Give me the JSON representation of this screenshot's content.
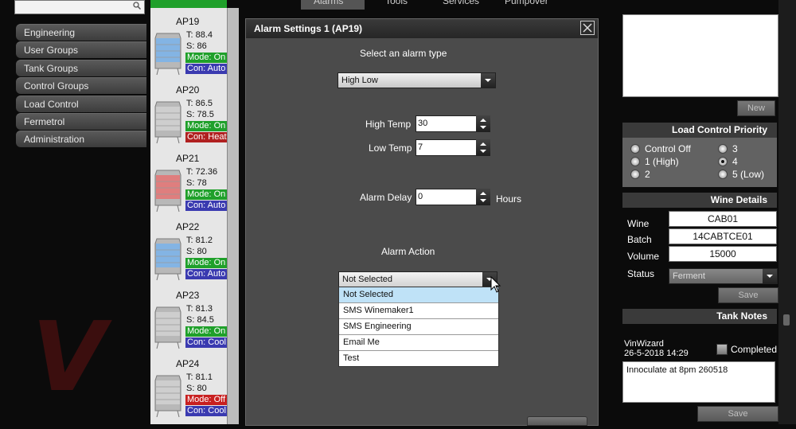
{
  "nav": {
    "items": [
      "Engineering",
      "User Groups",
      "Tank Groups",
      "Control Groups",
      "Load Control",
      "Fermetrol",
      "Administration"
    ]
  },
  "tanks": [
    {
      "name": "AP19",
      "t": "T: 88.4",
      "s": "S: 86",
      "mode": "Mode: On",
      "con": "Con: Auto",
      "fill": "blue"
    },
    {
      "name": "AP20",
      "t": "T: 86.5",
      "s": "S: 78.5",
      "mode": "Mode: On",
      "con": "Con: Heat",
      "fill": "none"
    },
    {
      "name": "AP21",
      "t": "T: 72.36",
      "s": "S: 78",
      "mode": "Mode: On",
      "con": "Con: Auto",
      "fill": "red"
    },
    {
      "name": "AP22",
      "t": "T: 81.2",
      "s": "S: 80",
      "mode": "Mode: On",
      "con": "Con: Auto",
      "fill": "blue"
    },
    {
      "name": "AP23",
      "t": "T: 81.3",
      "s": "S: 84.5",
      "mode": "Mode: On",
      "con": "Con: Cool",
      "fill": "none"
    },
    {
      "name": "AP24",
      "t": "T: 81.1",
      "s": "S: 80",
      "mode": "Mode: Off",
      "con": "Con: Cool",
      "fill": "none"
    }
  ],
  "tabs": [
    "Alarms",
    "Tools",
    "Services",
    "Pumpover"
  ],
  "modal": {
    "title": "Alarm Settings 1 (AP19)",
    "select_type_label": "Select an alarm type",
    "alarm_type_value": "High Low",
    "high_temp_label": "High Temp",
    "high_temp_value": "30",
    "low_temp_label": "Low Temp",
    "low_temp_value": "7",
    "alarm_delay_label": "Alarm Delay",
    "alarm_delay_value": "0",
    "hours_label": "Hours",
    "alarm_action_label": "Alarm Action",
    "alarm_action_value": "Not Selected",
    "action_options": [
      "Not Selected",
      "SMS Winemaker1",
      "SMS Engineering",
      "Email Me",
      "Test"
    ]
  },
  "right": {
    "new_button": "New",
    "load_control_header": "Load Control Priority",
    "priority_options": [
      {
        "label": "Control Off",
        "checked": false
      },
      {
        "label": "1 (High)",
        "checked": false
      },
      {
        "label": "2",
        "checked": false
      },
      {
        "label": "3",
        "checked": false
      },
      {
        "label": "4",
        "checked": true
      },
      {
        "label": "5 (Low)",
        "checked": false
      }
    ],
    "wine_details_header": "Wine Details",
    "wine_label": "Wine",
    "wine_value": "CAB01",
    "batch_label": "Batch",
    "batch_value": "14CABTCE01",
    "volume_label": "Volume",
    "volume_value": "15000",
    "status_label": "Status",
    "status_value": "Ferment",
    "save_button": "Save",
    "tank_notes_header": "Tank Notes",
    "notes_author": "VinWizard",
    "notes_datetime": "26-5-2018 14:29",
    "completed_label": "Completed",
    "notes_text": "Innoculate at 8pm 260518",
    "save_button_2": "Save"
  },
  "colors": {
    "mode_on": "#1fa02a",
    "mode_off": "#c82020",
    "con_cool": "#3a3ab0",
    "con_heat": "#b02020",
    "selected_item": "#bfe2f7"
  }
}
